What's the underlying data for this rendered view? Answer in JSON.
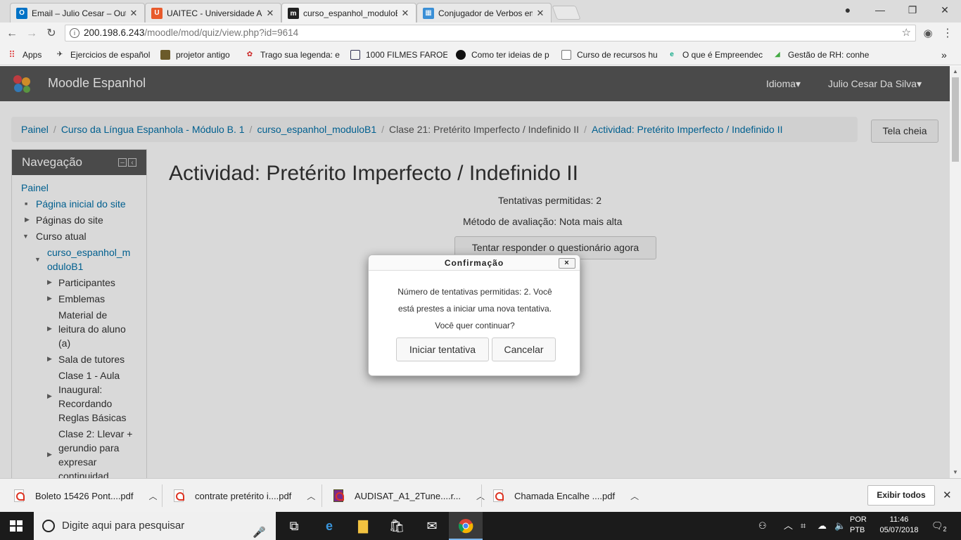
{
  "browser": {
    "tabs": [
      {
        "title": "Email – Julio Cesar – Outl",
        "icon": "outlook-icon",
        "color": "#0072c6"
      },
      {
        "title": "UAITEC - Universidade Ab",
        "icon": "uaitec-icon",
        "color": "#e85a2c"
      },
      {
        "title": "curso_espanhol_moduloB",
        "icon": "moodle-m-icon",
        "color": "#222222"
      },
      {
        "title": "Conjugador de Verbos em",
        "icon": "conjugador-icon",
        "color": "#3a8fd6"
      }
    ],
    "url_host": "200.198.6.243",
    "url_path": "/moodle/mod/quiz/view.php?id=9614",
    "bookmarks": [
      "Apps",
      "Ejercicios de español",
      "projetor antigo",
      "Trago sua legenda: e",
      "1000 FILMES FAROES",
      "Como ter ideias de p",
      "Curso de recursos hu",
      "O que é Empreendec",
      "Gestão de RH: conhe"
    ],
    "bookmarks_more": "»"
  },
  "site": {
    "name": "Moodle Espanhol",
    "menu_language": "Idioma",
    "menu_user": "Julio Cesar Da Silva",
    "brand_color": "#575757",
    "link_color": "#0070a8"
  },
  "breadcrumb": [
    {
      "label": "Painel",
      "link": true
    },
    {
      "label": "Curso da Língua Espanhola - Módulo B. 1",
      "link": true
    },
    {
      "label": "curso_espanhol_moduloB1",
      "link": true
    },
    {
      "label": "Clase 21: Pretérito Imperfecto / Indefinido II",
      "link": false
    },
    {
      "label": "Actividad: Pretérito Imperfecto / Indefinido II",
      "link": true
    }
  ],
  "fullscreen_button": "Tela cheia",
  "navigation": {
    "title": "Navegação",
    "painel": "Painel",
    "site_home": "Página inicial do site",
    "site_pages": "Páginas do site",
    "current_course": "Curso atual",
    "course_line1": "curso_espanhol_m",
    "course_line2": "oduloB1",
    "participants": "Participantes",
    "badges": "Emblemas",
    "material_l1": "Material de",
    "material_l2": "leitura do aluno",
    "material_l3": "(a)",
    "tutors": "Sala de tutores",
    "clase1_l1": "Clase 1 - Aula",
    "clase1_l2": "Inaugural:",
    "clase1_l3": "Recordando",
    "clase1_l4": "Reglas Básicas",
    "clase2_l1": "Clase 2: Llevar +",
    "clase2_l2": "gerundio para",
    "clase2_l3": "expresar",
    "clase2_l4": "continuidad"
  },
  "main": {
    "title": "Actividad: Pretérito Imperfecto / Indefinido II",
    "attempts_allowed": "Tentativas permitidas: 2",
    "grading_method": "Método de avaliação: Nota mais alta",
    "attempt_button": "Tentar responder o questionário agora"
  },
  "dialog": {
    "title": "Confirmação",
    "close": "×",
    "line1": "Número de tentativas permitidas: 2. Você",
    "line2": "está prestes a iniciar uma nova tentativa.",
    "line3": "Você quer continuar?",
    "start_button": "Iniciar tentativa",
    "cancel_button": "Cancelar"
  },
  "downloads": {
    "items": [
      "Boleto 15426 Pont....pdf",
      "contrate pretérito i....pdf",
      "AUDISAT_A1_2Tune....r...",
      "Chamada Encalhe ....pdf"
    ],
    "show_all": "Exibir todos"
  },
  "taskbar": {
    "search_placeholder": "Digite aqui para pesquisar",
    "lang1": "POR",
    "lang2": "PTB",
    "time": "11:46",
    "date": "05/07/2018",
    "notifications": "2"
  }
}
